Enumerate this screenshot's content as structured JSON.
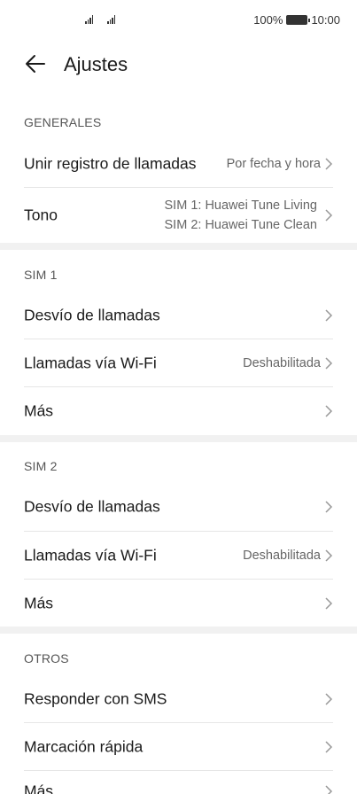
{
  "statusbar": {
    "battery": "100%",
    "time": "10:00"
  },
  "header": {
    "title": "Ajustes"
  },
  "sections": {
    "generales": {
      "title": "GENERALES",
      "merge_label": "Unir registro de llamadas",
      "merge_value": "Por fecha y hora",
      "tone_label": "Tono",
      "tone_value1": "SIM 1: Huawei Tune Living",
      "tone_value2": "SIM 2: Huawei Tune Clean"
    },
    "sim1": {
      "title": "SIM 1",
      "forward_label": "Desvío de llamadas",
      "wifi_label": "Llamadas vía Wi-Fi",
      "wifi_value": "Deshabilitada",
      "more_label": "Más"
    },
    "sim2": {
      "title": "SIM 2",
      "forward_label": "Desvío de llamadas",
      "wifi_label": "Llamadas vía Wi-Fi",
      "wifi_value": "Deshabilitada",
      "more_label": "Más"
    },
    "otros": {
      "title": "OTROS",
      "sms_label": "Responder con SMS",
      "speed_label": "Marcación rápida",
      "more_label": "Más"
    }
  },
  "icons": {
    "back": "arrow-left-icon",
    "chevron": "chevron-right-icon"
  }
}
